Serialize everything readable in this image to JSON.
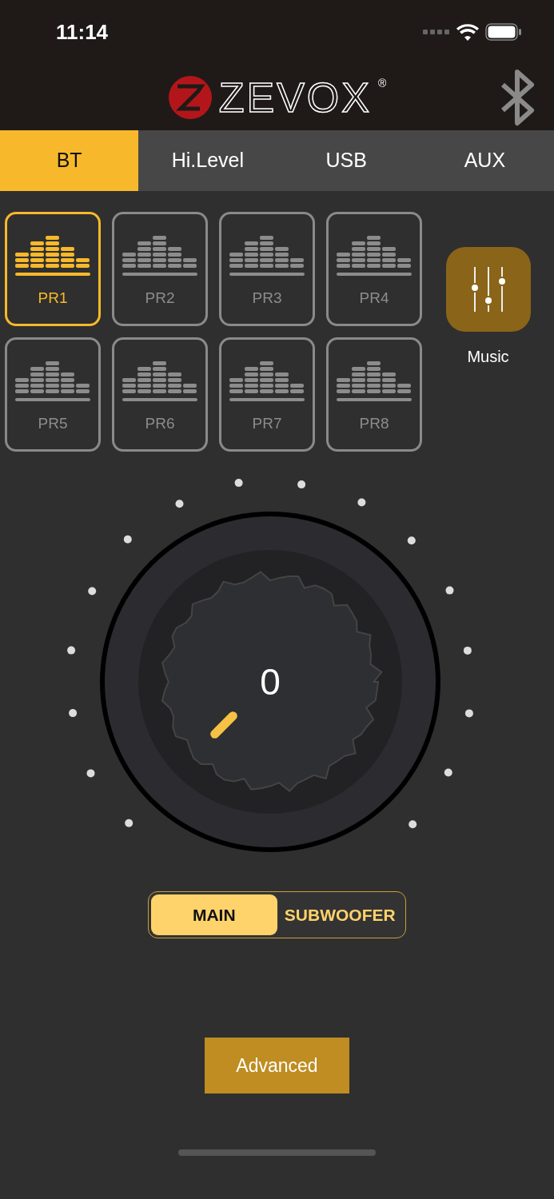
{
  "status_bar": {
    "time": "11:14"
  },
  "header": {
    "logo": "ZEVOX",
    "registered": "®"
  },
  "tabs": [
    {
      "label": "BT",
      "selected": true
    },
    {
      "label": "Hi.Level",
      "selected": false
    },
    {
      "label": "USB",
      "selected": false
    },
    {
      "label": "AUX",
      "selected": false
    }
  ],
  "presets": [
    {
      "label": "PR1",
      "selected": true
    },
    {
      "label": "PR2",
      "selected": false
    },
    {
      "label": "PR3",
      "selected": false
    },
    {
      "label": "PR4",
      "selected": false
    },
    {
      "label": "PR5",
      "selected": false
    },
    {
      "label": "PR6",
      "selected": false
    },
    {
      "label": "PR7",
      "selected": false
    },
    {
      "label": "PR8",
      "selected": false
    }
  ],
  "music_button": {
    "label": "Music"
  },
  "knob": {
    "value": "0"
  },
  "output_toggle": [
    {
      "label": "MAIN",
      "selected": true
    },
    {
      "label": "SUBWOOFER",
      "selected": false
    }
  ],
  "advanced_button": {
    "label": "Advanced"
  }
}
